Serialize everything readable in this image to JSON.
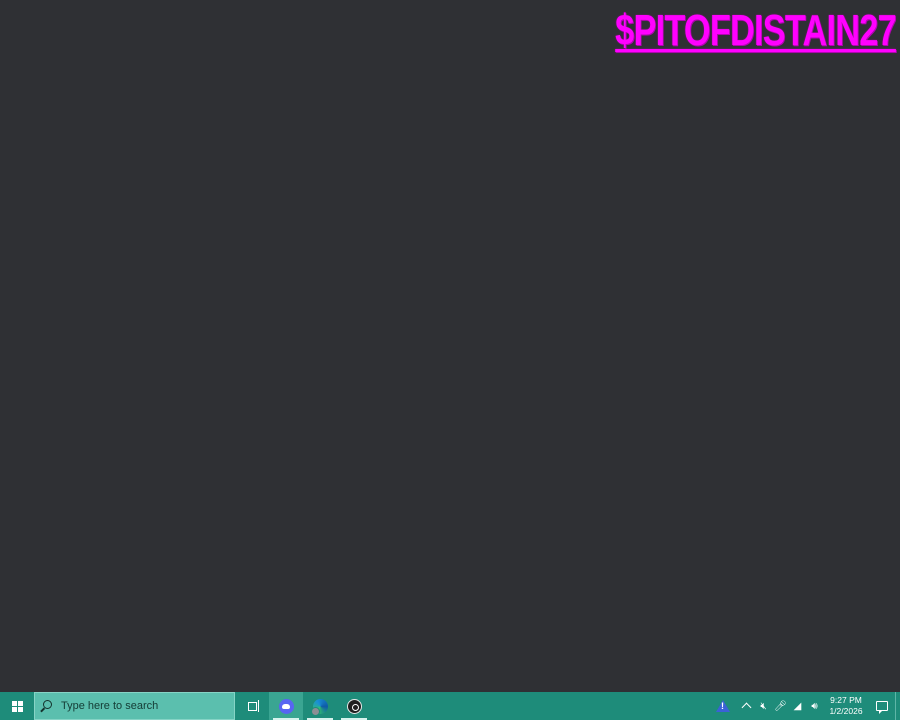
{
  "desktop": {
    "watermark_text": "$PITOFDISTAIN27",
    "background": "#2f3034",
    "watermark_color": "#ff00ff"
  },
  "taskbar": {
    "background": "#1e8c7a",
    "search": {
      "placeholder": "Type here to search"
    },
    "pinned_apps": [
      {
        "name": "task-view",
        "icon": "task-view-icon"
      },
      {
        "name": "discord",
        "icon": "discord-icon",
        "active": true
      },
      {
        "name": "edge",
        "icon": "edge-icon",
        "running": true
      },
      {
        "name": "obs-studio",
        "icon": "obs-icon",
        "running": true
      }
    ],
    "tray": {
      "icons": [
        "warning-icon",
        "chevron-up-icon",
        "muted-notifications-icon",
        "microphone-icon",
        "network-icon",
        "volume-icon"
      ],
      "time": "9:27 PM",
      "date": "1/2/2026"
    }
  }
}
